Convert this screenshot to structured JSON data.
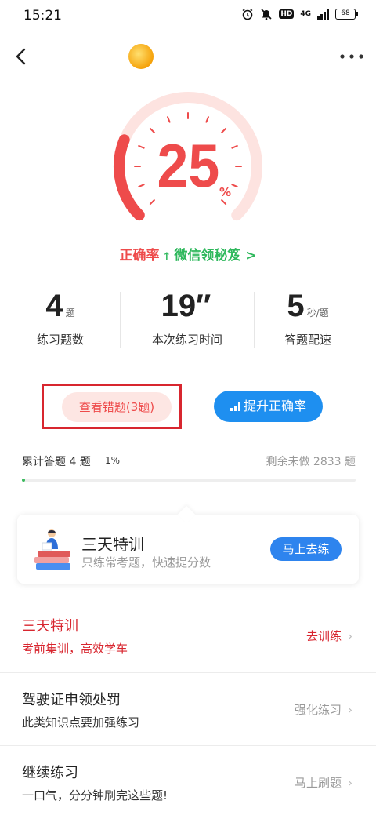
{
  "status_bar": {
    "time": "15:21",
    "icons": [
      "alarm-icon",
      "mute-icon",
      "hd-icon",
      "4g-signal-icon",
      "battery-icon"
    ],
    "hd_label": "HD",
    "network": "4G",
    "battery": "68"
  },
  "nav": {
    "back_icon": "back-arrow-icon",
    "more_icon": "more-dots-icon"
  },
  "gauge": {
    "accuracy_percent": 25,
    "value": "25",
    "unit": "%",
    "track_color": "#fde3e0",
    "fill_color": "#ee4b4b"
  },
  "accuracy": {
    "label": "正确率",
    "arrow": "↑",
    "link": "微信领秘笈",
    "link_chevron": ">"
  },
  "stats": [
    {
      "value": "4",
      "unit": "题",
      "label": "练习题数"
    },
    {
      "value": "19″",
      "unit": "",
      "label": "本次练习时间"
    },
    {
      "value": "5",
      "unit": "秒/题",
      "label": "答题配速"
    }
  ],
  "actions": {
    "wrong_questions": "查看错题(3题)",
    "improve_accuracy": "提升正确率"
  },
  "progress": {
    "total_label": "累计答题 4 题",
    "percent_label": "1%",
    "remaining_label": "剩余未做 2833 题",
    "fraction": 0.01
  },
  "promo": {
    "title": "三天特训",
    "subtitle": "只练常考题，快速提分数",
    "button": "马上去练"
  },
  "list": [
    {
      "title": "三天特训",
      "subtitle": "考前集训，高效学车",
      "action": "去训练"
    },
    {
      "title": "驾驶证申领处罚",
      "subtitle": "此类知识点要加强练习",
      "action": "强化练习"
    },
    {
      "title": "继续练习",
      "subtitle": "一口气，分分钟刷完这些题!",
      "action": "马上刷题"
    }
  ],
  "colors": {
    "accent_red": "#ee4b4b",
    "accent_green": "#2eb85c",
    "accent_blue": "#1e8ff0",
    "highlight_frame": "#d8262f"
  }
}
